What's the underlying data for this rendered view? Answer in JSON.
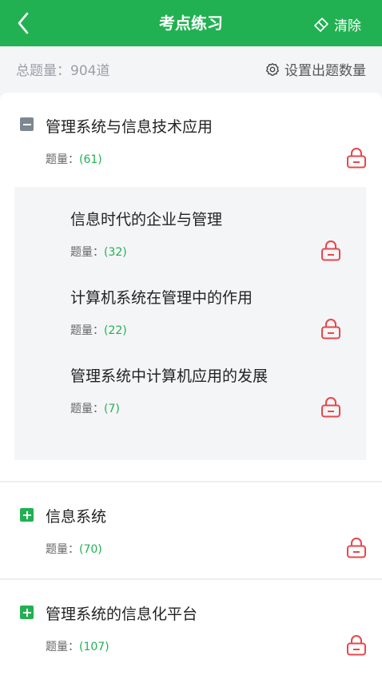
{
  "header": {
    "title": "考点练习",
    "clear_label": "清除"
  },
  "summary": {
    "total": "总题量：904道",
    "set_count_label": "设置出题数量"
  },
  "categories": [
    {
      "title": "管理系统与信息技术应用",
      "count_label": "题量：",
      "count_value": "(61)",
      "expanded": true,
      "children": [
        {
          "title": "信息时代的企业与管理",
          "count_label": "题量：",
          "count_value": "(32)"
        },
        {
          "title": "计算机系统在管理中的作用",
          "count_label": "题量：",
          "count_value": "(22)"
        },
        {
          "title": "管理系统中计算机应用的发展",
          "count_label": "题量：",
          "count_value": "(7)"
        }
      ]
    },
    {
      "title": "信息系统",
      "count_label": "题量：",
      "count_value": "(70)",
      "expanded": false
    },
    {
      "title": "管理系统的信息化平台",
      "count_label": "题量：",
      "count_value": "(107)",
      "expanded": false
    }
  ],
  "colors": {
    "brand": "#22b152",
    "lock": "#e8474a",
    "muted": "#9aa0a6"
  },
  "icons": {
    "back": "chevron-left-icon",
    "clear": "eraser-icon",
    "settings": "gear-icon",
    "lock": "lock-icon",
    "collapse": "minus-square-icon",
    "expand": "plus-square-icon"
  }
}
